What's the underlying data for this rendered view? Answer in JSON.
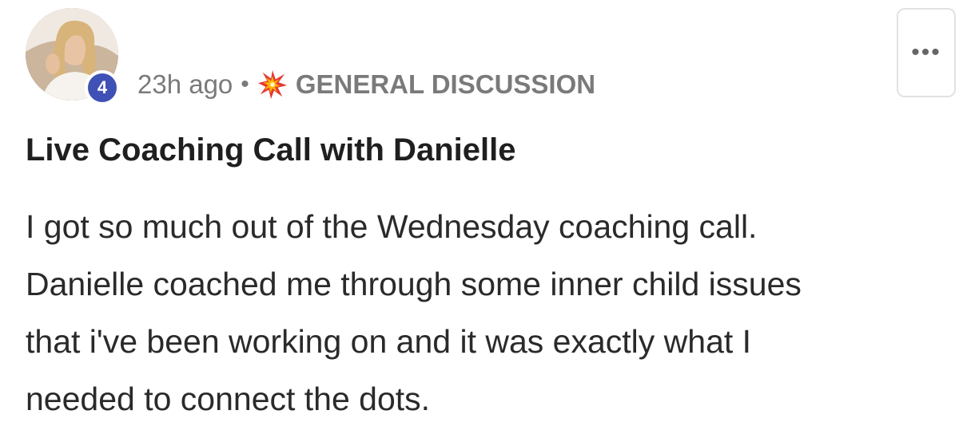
{
  "post": {
    "author_level": "4",
    "timestamp": "23h ago",
    "separator": "•",
    "category_icon": "collision-burst-icon",
    "category": "GENERAL DISCUSSION",
    "more_label": "•••",
    "title": "Live Coaching Call with Danielle",
    "body_lines": [
      "I got so much out of the Wednesday coaching call.",
      "Danielle coached me through some inner child issues",
      "that i've been working on and it was exactly what I",
      "needed to connect the dots."
    ]
  },
  "colors": {
    "badge": "#3f51b5",
    "meta_text": "#7a7a7a",
    "title_text": "#1f1f1f",
    "burst_outer": "#e53935",
    "burst_inner": "#ffb300"
  }
}
